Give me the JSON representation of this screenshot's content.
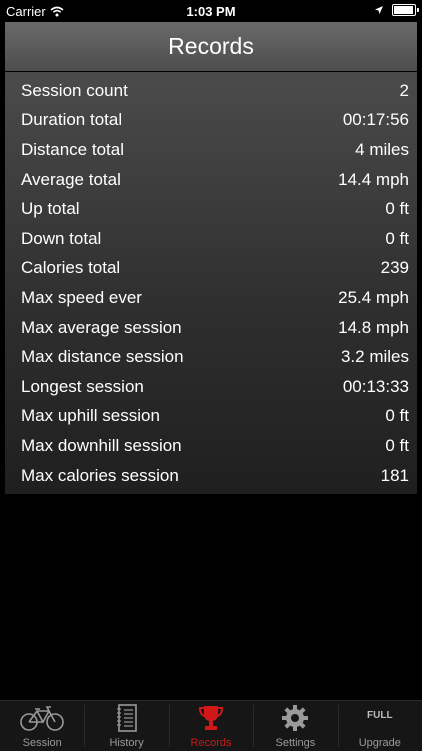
{
  "status_bar": {
    "carrier": "Carrier",
    "time": "1:03 PM"
  },
  "header": {
    "title": "Records"
  },
  "records": [
    {
      "label": "Session count",
      "value": "2"
    },
    {
      "label": "Duration total",
      "value": "00:17:56"
    },
    {
      "label": "Distance total",
      "value": "4 miles"
    },
    {
      "label": "Average total",
      "value": "14.4 mph"
    },
    {
      "label": "Up total",
      "value": "0 ft"
    },
    {
      "label": "Down total",
      "value": "0 ft"
    },
    {
      "label": "Calories total",
      "value": "239"
    },
    {
      "label": "Max speed ever",
      "value": "25.4 mph"
    },
    {
      "label": "Max average session",
      "value": "14.8 mph"
    },
    {
      "label": "Max distance session",
      "value": "3.2 miles"
    },
    {
      "label": "Longest session",
      "value": "00:13:33"
    },
    {
      "label": "Max uphill session",
      "value": "0 ft"
    },
    {
      "label": "Max downhill session",
      "value": "0 ft"
    },
    {
      "label": "Max calories session",
      "value": "181"
    }
  ],
  "tab_bar": {
    "tabs": [
      {
        "label": "Session",
        "icon": "bicycle-icon"
      },
      {
        "label": "History",
        "icon": "notebook-icon"
      },
      {
        "label": "Records",
        "icon": "trophy-icon",
        "active": true
      },
      {
        "label": "Settings",
        "icon": "gear-icon"
      },
      {
        "label": "Upgrade",
        "icon": "full-icon",
        "icon_text": "FULL"
      }
    ],
    "active_color": "#d01818",
    "inactive_color": "#9a9a9a"
  }
}
